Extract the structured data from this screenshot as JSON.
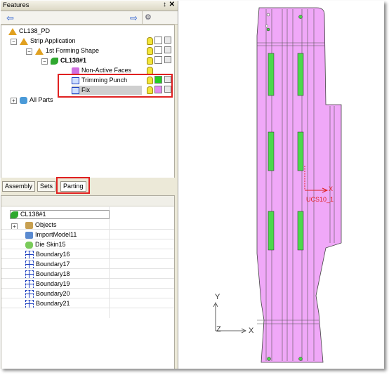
{
  "features_panel": {
    "title": "Features",
    "pin_glyph": "↕",
    "close_glyph": "✕",
    "tree": [
      {
        "label": "CL138_PD"
      },
      {
        "label": "Strip Application"
      },
      {
        "label": "1st Forming Shape"
      },
      {
        "label": "CL138#1"
      },
      {
        "label": "Non-Active Faces"
      },
      {
        "label": "Trimming Punch"
      },
      {
        "label": "Fix"
      },
      {
        "label": "All Parts"
      }
    ],
    "colors": {
      "trimming_punch": "#22cc22",
      "fix": "#e28af0"
    }
  },
  "tabs": [
    {
      "label": "Assembly"
    },
    {
      "label": "Sets"
    },
    {
      "label": "Parting"
    }
  ],
  "parting_tree": [
    {
      "label": "CL138#1"
    },
    {
      "label": "Objects"
    },
    {
      "label": "ImportModel11"
    },
    {
      "label": "Die Skin15"
    },
    {
      "label": "Boundary16"
    },
    {
      "label": "Boundary17"
    },
    {
      "label": "Boundary18"
    },
    {
      "label": "Boundary19"
    },
    {
      "label": "Boundary20"
    },
    {
      "label": "Boundary21"
    }
  ],
  "viewport": {
    "ucs_label": "UCS10_1",
    "axis_x": "X",
    "axis_y": "Y",
    "axis_z": "Z",
    "part_color": "#f0a8f8",
    "slot_color": "#4cd84c"
  }
}
